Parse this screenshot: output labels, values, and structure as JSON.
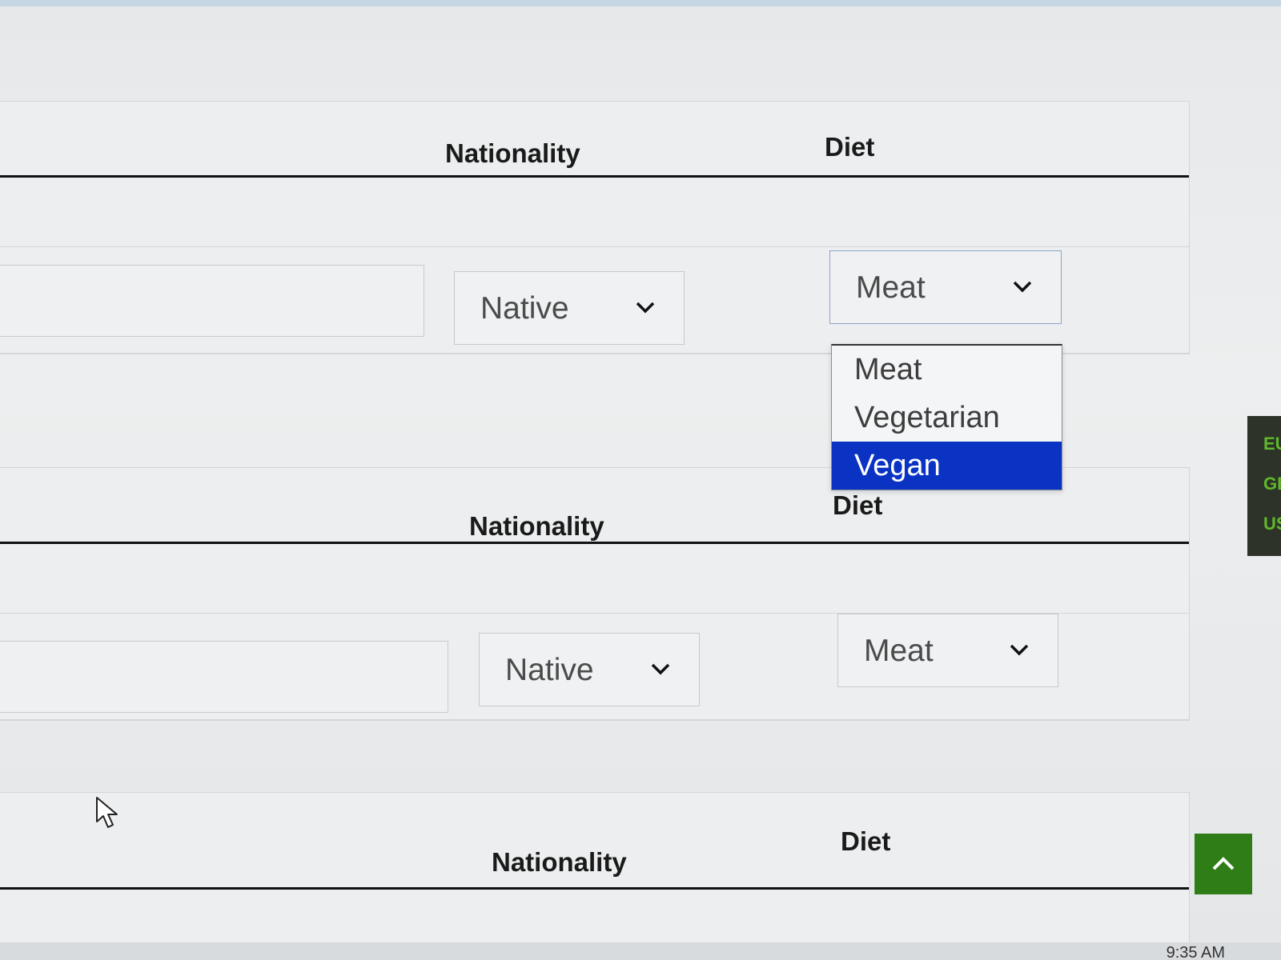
{
  "table_sections": [
    {
      "headers": {
        "nationality": "Nationality",
        "diet": "Diet"
      },
      "row": {
        "nationality_value": "Native",
        "diet_value": "Meat"
      }
    },
    {
      "headers": {
        "nationality": "Nationality",
        "diet": "Diet"
      },
      "row": {
        "nationality_value": "Native",
        "diet_value": "Meat"
      }
    },
    {
      "headers": {
        "nationality": "Nationality",
        "diet": "Diet"
      }
    }
  ],
  "diet_dropdown": {
    "options": [
      "Meat",
      "Vegetarian",
      "Vegan"
    ],
    "highlighted": "Vegan"
  },
  "side_panel": {
    "labels": [
      "EU",
      "GB",
      "US"
    ]
  },
  "taskbar": {
    "clock": "9:35 AM"
  },
  "colors": {
    "highlight": "#0a33c4",
    "back_to_top": "#2e7d16",
    "side_panel_text": "#5fb82b"
  },
  "icons": {
    "select_arrow": "chevron-down-icon",
    "back_to_top": "chevron-up-icon",
    "pointer": "mouse-cursor-icon"
  }
}
